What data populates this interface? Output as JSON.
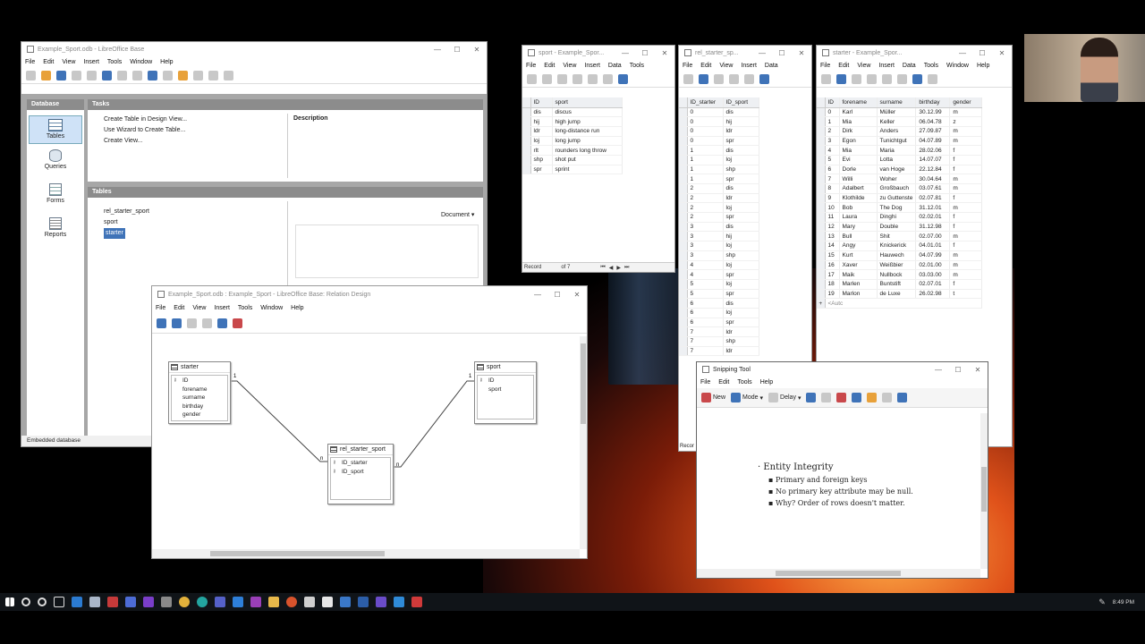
{
  "base_window": {
    "title": "Example_Sport.odb - LibreOffice Base",
    "menu": [
      "File",
      "Edit",
      "View",
      "Insert",
      "Tools",
      "Window",
      "Help"
    ],
    "database_header": "Database",
    "nav": [
      "Tables",
      "Queries",
      "Forms",
      "Reports"
    ],
    "tasks_header": "Tasks",
    "tasks": [
      "Create Table in Design View...",
      "Use Wizard to Create Table...",
      "Create View..."
    ],
    "description_label": "Description",
    "tables_header": "Tables",
    "tables": [
      "rel_starter_sport",
      "sport",
      "starter"
    ],
    "document_select": "Document",
    "status": "Embedded database"
  },
  "sport_window": {
    "title": "sport - Example_Spor...",
    "menu": [
      "File",
      "Edit",
      "View",
      "Insert",
      "Data",
      "Tools"
    ],
    "columns": [
      "ID",
      "sport"
    ],
    "rows": [
      [
        "dis",
        "discus"
      ],
      [
        "hij",
        "high jump"
      ],
      [
        "ldr",
        "long-distance run"
      ],
      [
        "loj",
        "long jump"
      ],
      [
        "rlt",
        "rounders long throw"
      ],
      [
        "shp",
        "shot put"
      ],
      [
        "spr",
        "sprint"
      ]
    ],
    "record_label": "Record",
    "record_of": "of 7"
  },
  "rel_window": {
    "title": "rel_starter_sp...",
    "menu": [
      "File",
      "Edit",
      "View",
      "Insert",
      "Data"
    ],
    "columns": [
      "ID_starter",
      "ID_sport"
    ],
    "rows": [
      [
        "0",
        "dis"
      ],
      [
        "0",
        "hij"
      ],
      [
        "0",
        "ldr"
      ],
      [
        "0",
        "spr"
      ],
      [
        "1",
        "dis"
      ],
      [
        "1",
        "loj"
      ],
      [
        "1",
        "shp"
      ],
      [
        "1",
        "spr"
      ],
      [
        "2",
        "dis"
      ],
      [
        "2",
        "ldr"
      ],
      [
        "2",
        "loj"
      ],
      [
        "2",
        "spr"
      ],
      [
        "3",
        "dis"
      ],
      [
        "3",
        "hij"
      ],
      [
        "3",
        "loj"
      ],
      [
        "3",
        "shp"
      ],
      [
        "4",
        "loj"
      ],
      [
        "4",
        "spr"
      ],
      [
        "5",
        "loj"
      ],
      [
        "5",
        "spr"
      ],
      [
        "6",
        "dis"
      ],
      [
        "6",
        "loj"
      ],
      [
        "6",
        "spr"
      ],
      [
        "7",
        "ldr"
      ],
      [
        "7",
        "shp"
      ],
      [
        "7",
        "ldr"
      ]
    ],
    "record_label": "Recor"
  },
  "starter_window": {
    "title": "starter - Example_Spor...",
    "menu": [
      "File",
      "Edit",
      "View",
      "Insert",
      "Data",
      "Tools",
      "Window",
      "Help"
    ],
    "columns": [
      "ID",
      "forename",
      "surname",
      "birthday",
      "gender"
    ],
    "rows": [
      [
        "0",
        "Karl",
        "Müller",
        "30.12.99",
        "m"
      ],
      [
        "1",
        "Mia",
        "Keller",
        "06.04.78",
        "z"
      ],
      [
        "2",
        "Dirk",
        "Anders",
        "27.09.87",
        "m"
      ],
      [
        "3",
        "Egon",
        "Tunichtgut",
        "04.07.89",
        "m"
      ],
      [
        "4",
        "Mia",
        "Maria",
        "28.02.06",
        "f"
      ],
      [
        "5",
        "Evi",
        "Lotta",
        "14.07.07",
        "f"
      ],
      [
        "6",
        "Dorle",
        "van Hoge",
        "22.12.84",
        "f"
      ],
      [
        "7",
        "Willi",
        "Woher",
        "30.04.64",
        "m"
      ],
      [
        "8",
        "Adalbert",
        "Großbauch",
        "03.07.61",
        "m"
      ],
      [
        "9",
        "Klothilde",
        "zu Guttenste",
        "02.07.81",
        "f"
      ],
      [
        "10",
        "Bob",
        "The Dog",
        "31.12.01",
        "m"
      ],
      [
        "11",
        "Laura",
        "Dinghi",
        "02.02.01",
        "f"
      ],
      [
        "12",
        "Mary",
        "Double",
        "31.12.98",
        "f"
      ],
      [
        "13",
        "Bull",
        "Shit",
        "02.07.00",
        "m"
      ],
      [
        "14",
        "Angy",
        "Knickerick",
        "04.01.01",
        "f"
      ],
      [
        "15",
        "Kurt",
        "Hauwech",
        "04.07.99",
        "m"
      ],
      [
        "16",
        "Xaver",
        "Weißbier",
        "02.01.00",
        "m"
      ],
      [
        "17",
        "Maik",
        "Nullbock",
        "03.03.00",
        "m"
      ],
      [
        "18",
        "Marlen",
        "Buntstift",
        "02.07.01",
        "f"
      ],
      [
        "19",
        "Marlon",
        "de Luxe",
        "26.02.98",
        "t"
      ]
    ],
    "new_row": "<Autc"
  },
  "relation_window": {
    "title": "Example_Sport.odb : Example_Sport - LibreOffice Base: Relation Design",
    "menu": [
      "File",
      "Edit",
      "View",
      "Insert",
      "Tools",
      "Window",
      "Help"
    ],
    "starter_table": {
      "name": "starter",
      "fields": [
        "ID",
        "forename",
        "surname",
        "birthday",
        "gender"
      ]
    },
    "sport_table": {
      "name": "sport",
      "fields": [
        "ID",
        "sport"
      ]
    },
    "rel_table": {
      "name": "rel_starter_sport",
      "fields": [
        "ID_starter",
        "ID_sport"
      ]
    },
    "card_one": "1",
    "card_many": "n"
  },
  "snipping_window": {
    "title": "Snipping Tool",
    "menu": [
      "File",
      "Edit",
      "Tools",
      "Help"
    ],
    "new_label": "New",
    "mode_label": "Mode",
    "delay_label": "Delay",
    "bullet_main": "Entity Integrity",
    "bullets": [
      "Primary and foreign keys",
      "No primary key attribute may be null.",
      "Why? Order of rows doesn't matter."
    ]
  },
  "taskbar": {
    "clock": "8:49 PM"
  },
  "colors": {
    "taskbar": "#101418",
    "base_panel": "#a7a7a7",
    "accent": "#3f73b8"
  }
}
